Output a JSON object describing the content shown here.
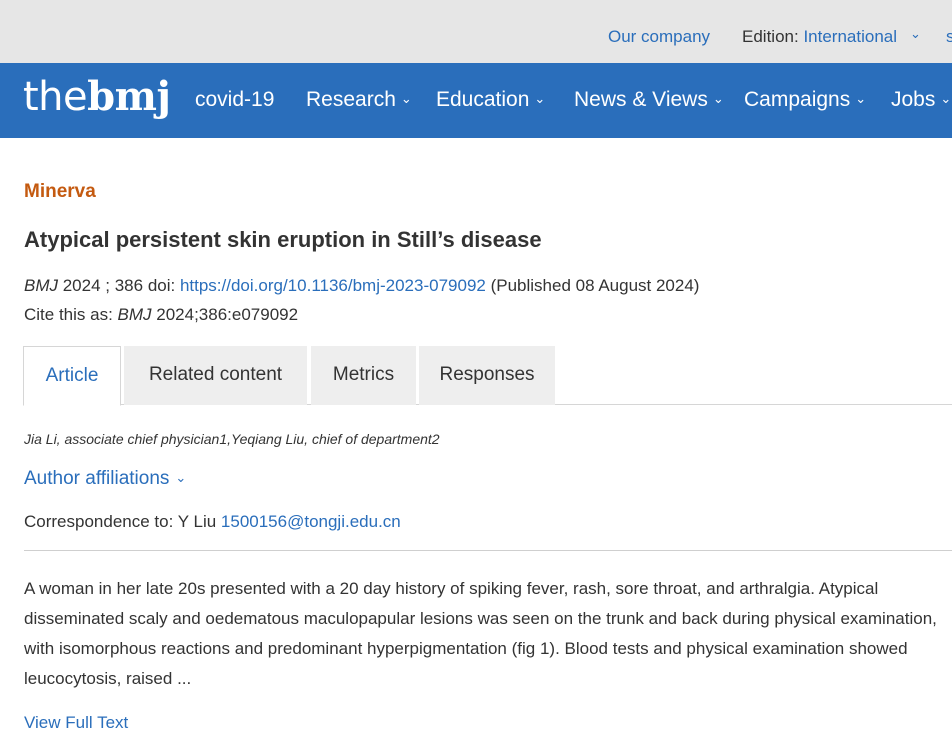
{
  "util_bar": {
    "our_company": "Our company",
    "edition_label": "Edition:",
    "edition_value": "International",
    "chevron_glyph": "⌄"
  },
  "nav": {
    "logo_light": "the",
    "logo_bold": "bmj",
    "items": [
      {
        "label": "covid-19",
        "has_menu": false
      },
      {
        "label": "Research",
        "has_menu": true
      },
      {
        "label": "Education",
        "has_menu": true
      },
      {
        "label": "News & Views",
        "has_menu": true
      },
      {
        "label": "Campaigns",
        "has_menu": true
      },
      {
        "label": "Jobs",
        "has_menu": true
      }
    ],
    "chevron_glyph": "⌄"
  },
  "article": {
    "section": "Minerva",
    "title": "Atypical persistent skin eruption in Still’s disease",
    "journal": "BMJ",
    "year_volume": " 2024 ; 386 ",
    "doi_label": "doi: ",
    "doi_url": "https://doi.org/10.1136/bmj-2023-079092",
    "published": " (Published 08 August 2024)",
    "cite_label": "Cite this as: ",
    "cite_journal": "BMJ",
    "cite_ref": " 2024;386:e079092"
  },
  "tabs": [
    {
      "label": "Article",
      "active": true
    },
    {
      "label": "Related content",
      "active": false
    },
    {
      "label": "Metrics",
      "active": false
    },
    {
      "label": "Responses",
      "active": false
    }
  ],
  "authors": "Jia Li, associate chief physician1,Yeqiang Liu, chief of department2",
  "affiliations_label": "Author affiliations",
  "affiliations_chevron": "⌄",
  "correspondence": {
    "label": "Correspondence to: Y Liu ",
    "email": "1500156@tongji.edu.cn"
  },
  "abstract": "A woman in her late 20s presented with a 20 day history of spiking fever, rash, sore throat, and arthralgia. Atypical disseminated scaly and oedematous maculopapular lesions was seen on the trunk and back during physical examination, with isomorphous reactions and predominant hyperpigmentation (fig 1). Blood tests and physical examination showed leucocytosis, raised ...",
  "full_text_label": "View Full Text",
  "colors": {
    "brand_blue": "#2a6ebb",
    "section_orange": "#c45a10",
    "util_bar_grey": "#e6e6e6"
  }
}
